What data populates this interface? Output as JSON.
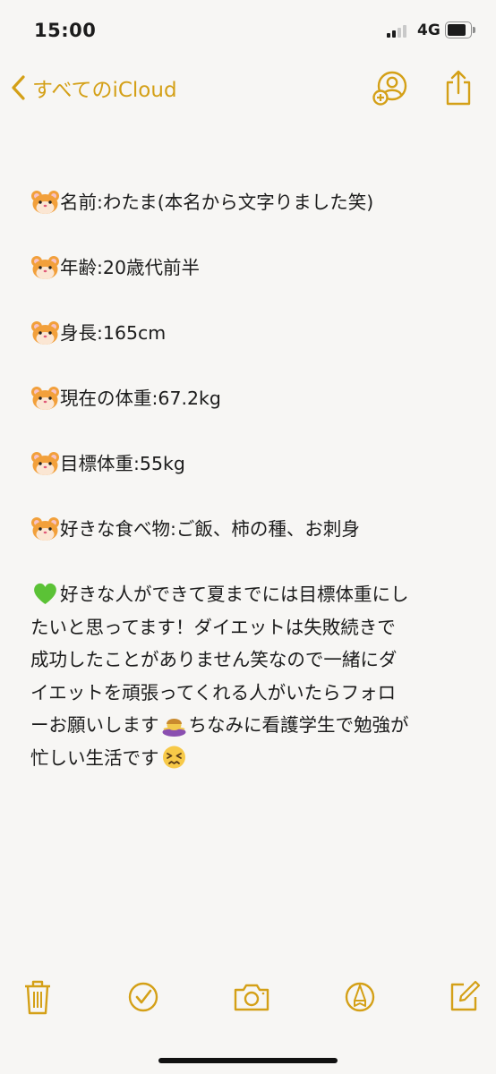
{
  "status_bar": {
    "time": "15:00",
    "network": "4G"
  },
  "nav": {
    "back_label": "すべてのiCloud",
    "accent_color": "#d4a017",
    "back_icon": "chevron-left-icon",
    "share_person_icon": "person-add-icon",
    "share_icon": "share-icon"
  },
  "note": {
    "lines": [
      {
        "icon": "hamster-icon",
        "text": "名前:わたま(本名から文字りました笑)"
      },
      {
        "icon": "hamster-icon",
        "text": "年齢:20歳代前半"
      },
      {
        "icon": "hamster-icon",
        "text": "身長:165cm"
      },
      {
        "icon": "hamster-icon",
        "text": "現在の体重:67.2kg"
      },
      {
        "icon": "hamster-icon",
        "text": "目標体重:55kg"
      },
      {
        "icon": "hamster-icon",
        "text": "好きな食べ物:ご飯、柿の種、お刺身"
      }
    ],
    "paragraph": {
      "lead_icon": "green-heart-icon",
      "line1": "好きな人ができて夏までには目標体重にし",
      "line2": "たいと思ってます！ダイエットは失敗続きで",
      "line3": "成功したことがありません笑なので一緒にダ",
      "line4": "イエットを頑張ってくれる人がいたらフォロ",
      "line5a": "ーお願いします",
      "mid_icon": "bowing-person-icon",
      "line5b": "ちなみに看護学生で勉強が",
      "line6": "忙しい生活です",
      "end_icon": "persevering-face-icon"
    }
  },
  "toolbar": {
    "items": [
      "trash-icon",
      "checklist-icon",
      "camera-icon",
      "markup-icon",
      "compose-icon"
    ]
  }
}
